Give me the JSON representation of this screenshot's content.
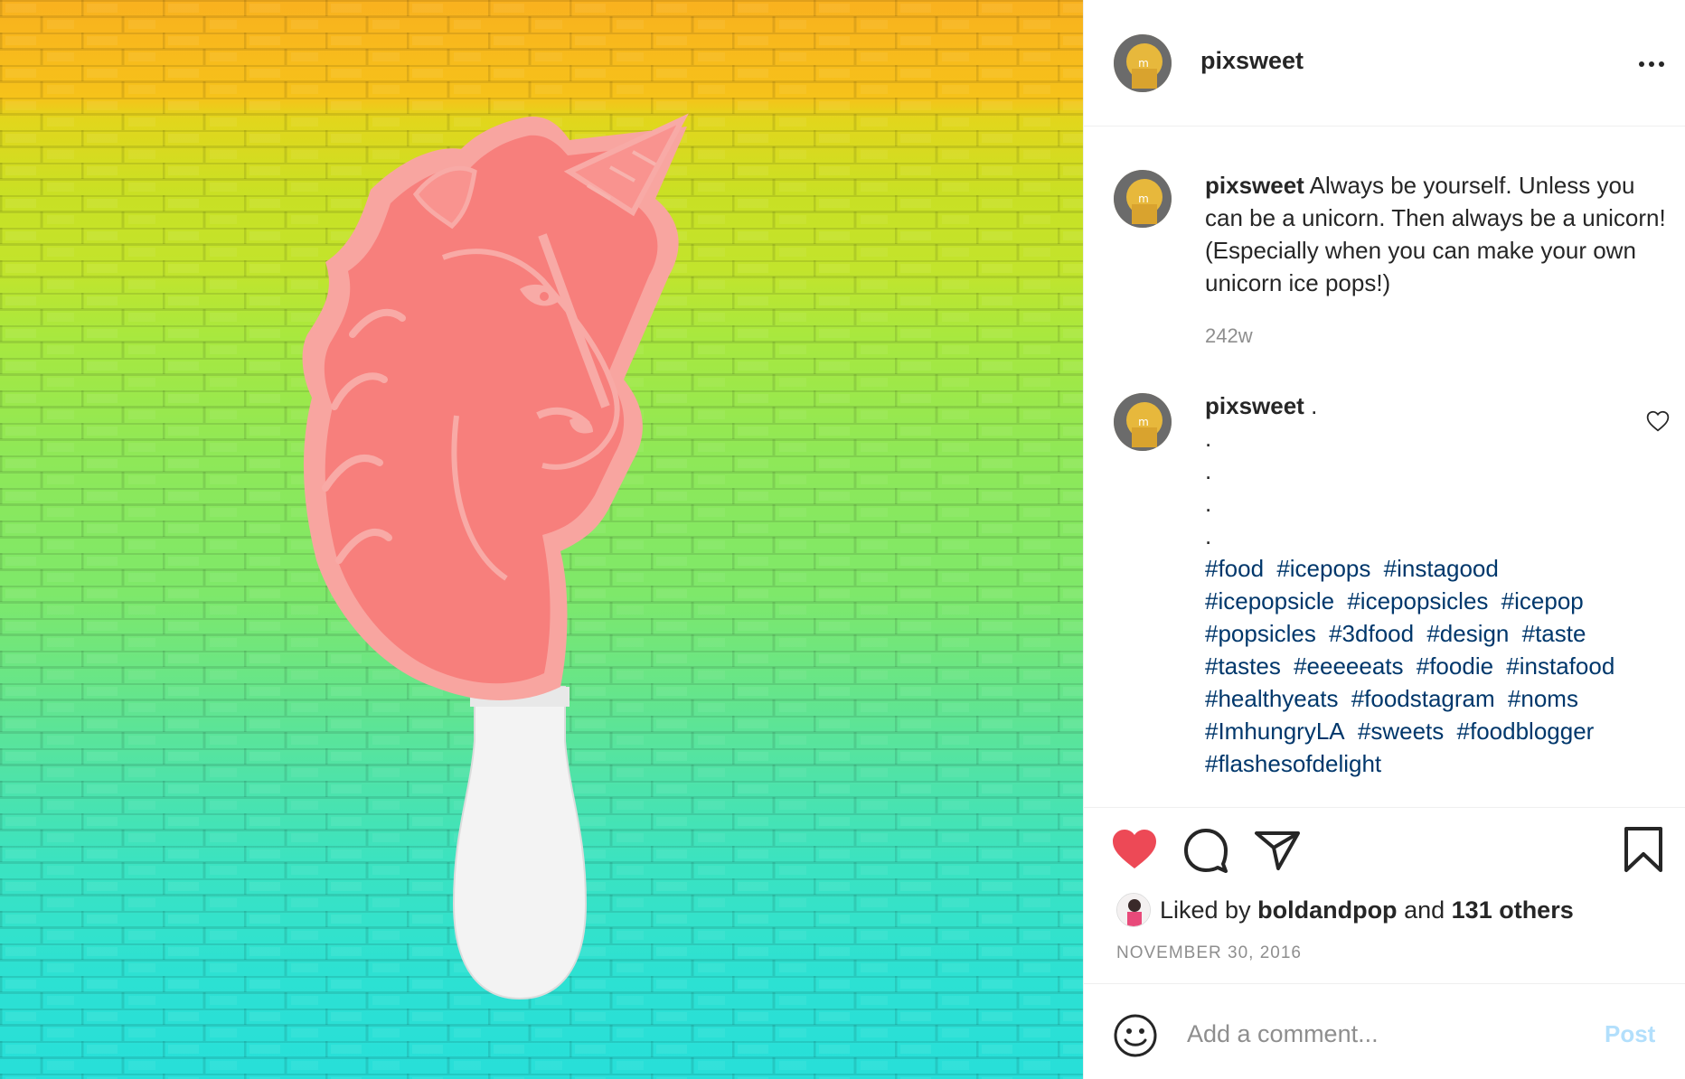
{
  "post": {
    "author": "pixsweet",
    "caption": "Always be yourself. Unless you can be a unicorn. Then always be a unicorn! (Especially when you can make your own unicorn ice pops!)",
    "age": "242w"
  },
  "comment": {
    "author": "pixsweet",
    "first_line": ".",
    "dots": [
      ".",
      ".",
      ".",
      "."
    ],
    "hashtags": [
      "#food",
      "#icepops",
      "#instagood",
      "#icepopsicle",
      "#icepopsicles",
      "#icepop",
      "#popsicles",
      "#3dfood",
      "#design",
      "#taste",
      "#tastes",
      "#eeeeeats",
      "#foodie",
      "#instafood",
      "#healthyeats",
      "#foodstagram",
      "#noms",
      "#ImhungryLA",
      "#sweets",
      "#foodblogger",
      "#flashesofdelight"
    ]
  },
  "likes": {
    "prefix": "Liked by",
    "user": "boldandpop",
    "joiner": "and",
    "others": "131 others"
  },
  "date": "NOVEMBER 30, 2016",
  "add_comment": {
    "placeholder": "Add a comment...",
    "post_label": "Post"
  },
  "icons": {
    "like": "heart-filled-icon",
    "comment": "comment-bubble-icon",
    "share": "paper-plane-icon",
    "save": "bookmark-icon",
    "more": "more-options-icon",
    "emoji": "emoji-icon"
  },
  "colors": {
    "like_red": "#ed4956",
    "hashtag_blue": "#00376b",
    "post_disabled": "#b2dffc",
    "muted": "#8e8e8e",
    "popsicle_pink": "#f77f7c",
    "stick_white": "#f5f5f5"
  }
}
